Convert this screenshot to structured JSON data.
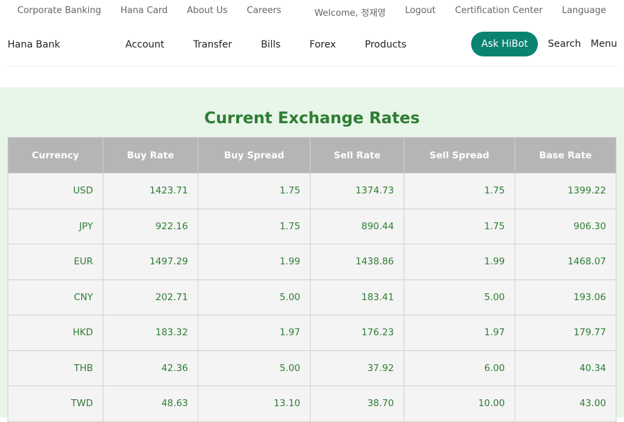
{
  "topbar": {
    "left_links": [
      "Corporate Banking",
      "Hana Card",
      "About Us",
      "Careers"
    ],
    "welcome": "Welcome, 정재영",
    "right_links": [
      "Logout",
      "Certification Center",
      "Language"
    ]
  },
  "navbar": {
    "brand": "Hana Bank",
    "links": [
      "Account",
      "Transfer",
      "Bills",
      "Forex",
      "Products"
    ],
    "ask_hibot": "Ask HiBot",
    "search": "Search",
    "menu": "Menu"
  },
  "rates": {
    "title": "Current Exchange Rates",
    "headers": [
      "Currency",
      "Buy Rate",
      "Buy Spread",
      "Sell Rate",
      "Sell Spread",
      "Base Rate"
    ],
    "rows": [
      [
        "USD",
        "1423.71",
        "1.75",
        "1374.73",
        "1.75",
        "1399.22"
      ],
      [
        "JPY",
        "922.16",
        "1.75",
        "890.44",
        "1.75",
        "906.30"
      ],
      [
        "EUR",
        "1497.29",
        "1.99",
        "1438.86",
        "1.99",
        "1468.07"
      ],
      [
        "CNY",
        "202.71",
        "5.00",
        "183.41",
        "5.00",
        "193.06"
      ],
      [
        "HKD",
        "183.32",
        "1.97",
        "176.23",
        "1.97",
        "179.77"
      ],
      [
        "THB",
        "42.36",
        "5.00",
        "37.92",
        "6.00",
        "40.34"
      ],
      [
        "TWD",
        "48.63",
        "13.10",
        "38.70",
        "10.00",
        "43.00"
      ]
    ]
  }
}
